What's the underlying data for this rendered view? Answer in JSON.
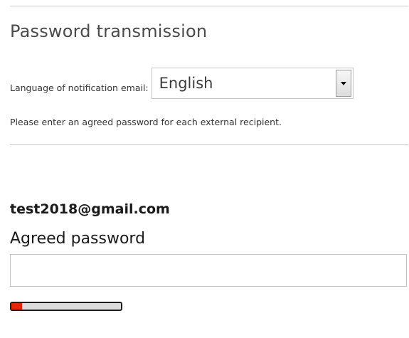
{
  "section": {
    "title": "Password transmission"
  },
  "language": {
    "label": "Language of notification email:",
    "selected": "English"
  },
  "hint": "Please enter an agreed password for each external recipient.",
  "recipient": {
    "email": "test2018@gmail.com",
    "password_label": "Agreed password",
    "password_value": "",
    "strength_fraction": 0.1,
    "strength_color": "#e8250c"
  }
}
